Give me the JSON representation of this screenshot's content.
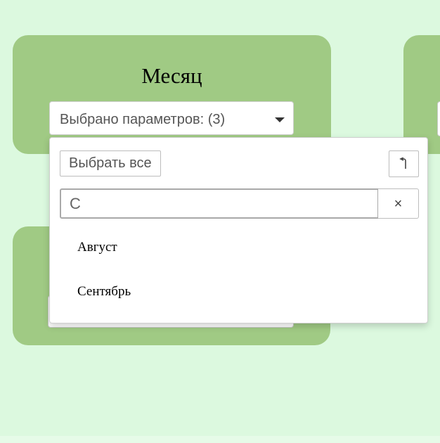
{
  "cards": {
    "month": {
      "title": "Месяц",
      "select": {
        "label": "Выбрано параметров: (3)"
      }
    }
  },
  "dropdown": {
    "select_all_label": "Выбрать все",
    "undo_icon": "undo-icon",
    "search": {
      "value": "С",
      "placeholder": ""
    },
    "clear_label": "×",
    "options": [
      {
        "label": "Август"
      },
      {
        "label": "Сентябрь"
      }
    ]
  },
  "colors": {
    "background": "#dcf9df",
    "card": "#a0ca84"
  }
}
